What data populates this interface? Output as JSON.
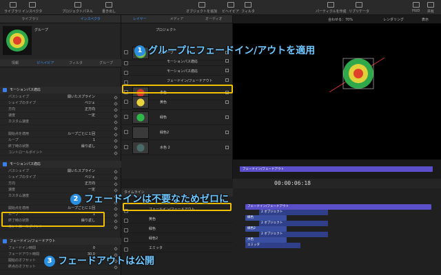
{
  "toolbar": {
    "items": [
      "ライブラリ",
      "インスペクタ",
      "プロジェクトパネル",
      "書き出し",
      "オブジェクトを追加",
      "ビヘイビア",
      "フィルタ",
      "パーティクルを作成",
      "リプリケータ",
      "HUD",
      "共有"
    ]
  },
  "left_tabs_top": [
    "ライブラリ",
    "インスペクタ"
  ],
  "preview_name": "グループ",
  "left_tabs": [
    "情報",
    "ビヘイビア",
    "フィルタ",
    "グループ"
  ],
  "sections": [
    {
      "title": "モーションパス適応",
      "rows": [
        {
          "label": "パスシェイプ",
          "value": "開いたスプライン"
        },
        {
          "label": "シェイプのタイプ",
          "value": "ベジェ"
        },
        {
          "label": "方向",
          "value": "正方向"
        },
        {
          "label": "速度",
          "value": "一定"
        },
        {
          "label": "カスタム速度",
          "value": ""
        },
        {
          "label": "",
          "value": ""
        },
        {
          "label": "開始点を適用",
          "value": "ループごとに１回"
        },
        {
          "label": "ループ",
          "value": "1"
        },
        {
          "label": "終了時の状態",
          "value": "繰り返し"
        },
        {
          "label": "コントロールポイント",
          "value": ""
        }
      ]
    },
    {
      "title": "モーションパス適応",
      "rows": [
        {
          "label": "パスシェイプ",
          "value": "開いたスプライン"
        },
        {
          "label": "シェイプのタイプ",
          "value": "ベジェ"
        },
        {
          "label": "方向",
          "value": "正方向"
        },
        {
          "label": "速度",
          "value": "一定"
        },
        {
          "label": "カスタム速度",
          "value": ""
        },
        {
          "label": "",
          "value": ""
        },
        {
          "label": "開始点を適用",
          "value": "ループごとに１回"
        },
        {
          "label": "ループ",
          "value": "1"
        },
        {
          "label": "終了時の状態",
          "value": "繰り返し"
        },
        {
          "label": "コントロールポイント",
          "value": ""
        }
      ]
    },
    {
      "title": "フェードイン/フェードアウト",
      "rows": [
        {
          "label": "フェードイン時間",
          "value": "0"
        },
        {
          "label": "フェードアウト時間",
          "value": "30.0"
        },
        {
          "label": "開始のオフセット",
          "value": ""
        },
        {
          "label": "終点のオフセット",
          "value": ""
        }
      ]
    }
  ],
  "layer_tabs": [
    "レイヤー",
    "メディア",
    "オーディオ"
  ],
  "project_label": "プロジェクト",
  "layers": [
    "グループ",
    "モーションパス適応",
    "モーションパス適応",
    "フェードイン/フェードアウト",
    "赤色",
    "黄色",
    "緑色",
    "緑色2",
    "水色 2"
  ],
  "canvas_top": {
    "zoom": "合わせる：70%",
    "render": "レンダリング",
    "view": "表示"
  },
  "mini_timeline_label": "フェードイン/フェードアウト",
  "timecode": "00:00:06:18",
  "timeline": {
    "title": "タイムライン",
    "tracks": [
      "フェードイン/フェードアウト",
      "黄色",
      "緑色",
      "緑色2",
      "エミッタ"
    ],
    "clips": [
      "フェードイン/フェードアウト",
      "2 オブジェクト",
      "緑色",
      "2 オブジェクト",
      "緑色2",
      "2 オブジェクト",
      "水色",
      "エミッタ"
    ]
  },
  "callouts": [
    {
      "num": "1",
      "text": "グループにフェードイン/アウトを適用"
    },
    {
      "num": "2",
      "text": "フェードインは不要なためゼロに"
    },
    {
      "num": "3",
      "text": "フェードアウトは公開"
    }
  ],
  "colors": {
    "accent": "#3d8fff",
    "highlight": "#f2c200",
    "callout": "#6ec6ff",
    "clip": "#5a4fc8"
  }
}
